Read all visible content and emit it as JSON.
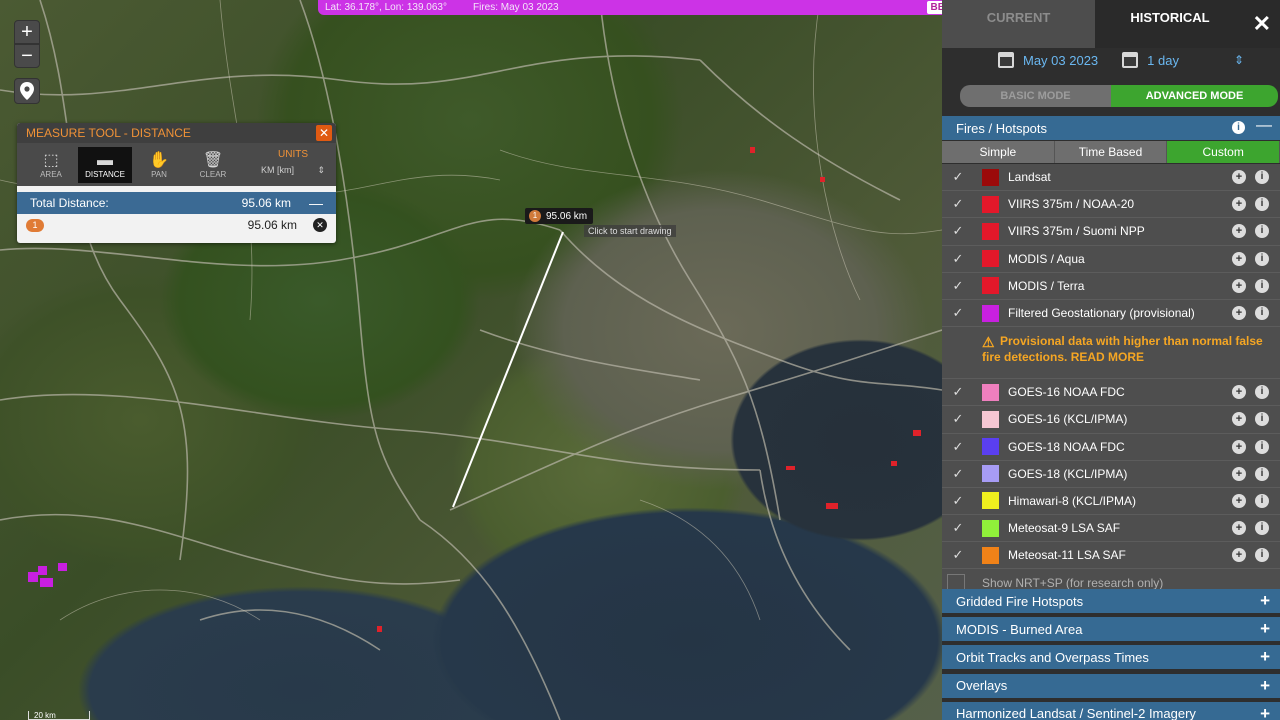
{
  "topbar": {
    "coords": "Lat: 36.178°, Lon: 139.063°",
    "fires": "Fires: May 03 2023",
    "beta": "BETA"
  },
  "map_controls": {
    "zoom_in": "+",
    "zoom_out": "−"
  },
  "measure": {
    "title": "MEASURE TOOL - DISTANCE",
    "close": "✕",
    "tools": [
      {
        "label": "AREA"
      },
      {
        "label": "DISTANCE"
      },
      {
        "label": "PAN"
      },
      {
        "label": "CLEAR"
      }
    ],
    "units_label": "UNITS",
    "units_value": "KM [km]",
    "total_label": "Total Distance:",
    "total_value": "95.06 km",
    "segment_badge": "1",
    "segment_value": "95.06 km"
  },
  "map_overlay": {
    "label_badge": "1",
    "label_value": "95.06 km",
    "hint": "Click to start drawing",
    "scale": "20 km"
  },
  "panel": {
    "tab_current": "CURRENT",
    "tab_historical": "HISTORICAL",
    "date": "May 03 2023",
    "range": "1 day",
    "mode_basic": "BASIC MODE",
    "mode_advanced": "ADVANCED MODE",
    "fires_title": "Fires / Hotspots",
    "subtabs": [
      "Simple",
      "Time Based",
      "Custom"
    ],
    "layers_top": [
      {
        "name": "Landsat",
        "color": "#9b0a0a"
      },
      {
        "name": "VIIRS 375m / NOAA-20",
        "color": "#e3182a"
      },
      {
        "name": "VIIRS 375m / Suomi NPP",
        "color": "#e3182a"
      },
      {
        "name": "MODIS / Aqua",
        "color": "#e3182a"
      },
      {
        "name": "MODIS / Terra",
        "color": "#e3182a"
      },
      {
        "name": "Filtered Geostationary (provisional)",
        "color": "#c820e0"
      }
    ],
    "warning": "Provisional data with higher than normal false fire detections. READ MORE",
    "layers_bottom": [
      {
        "name": "GOES-16 NOAA FDC",
        "color": "#ef7fbe"
      },
      {
        "name": "GOES-16 (KCL/IPMA)",
        "color": "#f6c7d3"
      },
      {
        "name": "GOES-18 NOAA FDC",
        "color": "#5a3ff0"
      },
      {
        "name": "GOES-18 (KCL/IPMA)",
        "color": "#a79cf5"
      },
      {
        "name": "Himawari-8 (KCL/IPMA)",
        "color": "#f0f01e"
      },
      {
        "name": "Meteosat-9 LSA SAF",
        "color": "#90f03a"
      },
      {
        "name": "Meteosat-11 LSA SAF",
        "color": "#f08218"
      }
    ],
    "nrt": "Show NRT+SP (for research only)",
    "sections": [
      "Gridded Fire Hotspots",
      "MODIS - Burned Area",
      "Orbit Tracks and Overpass Times",
      "Overlays",
      "Harmonized Landsat / Sentinel-2 Imagery"
    ]
  }
}
